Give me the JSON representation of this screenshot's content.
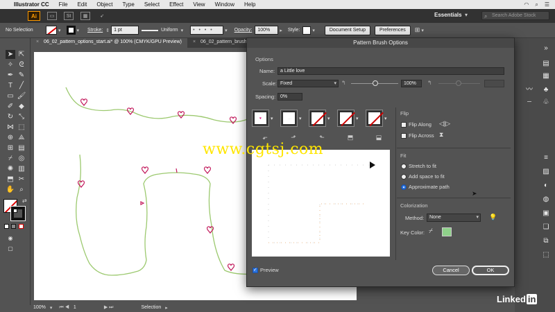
{
  "menubar": {
    "app_name": "Illustrator CC",
    "items": [
      "File",
      "Edit",
      "Object",
      "Type",
      "Select",
      "Effect",
      "View",
      "Window",
      "Help"
    ]
  },
  "appbar": {
    "logo": "Ai",
    "st_label": "St",
    "workspace": "Essentials",
    "search_placeholder": "Search Adobe Stock"
  },
  "control_bar": {
    "selection": "No Selection",
    "stroke_label": "Stroke:",
    "stroke_weight": "1 pt",
    "profile": "Uniform",
    "opacity_label": "Opacity:",
    "opacity_value": "100%",
    "style_label": "Style:",
    "document_setup": "Document Setup",
    "preferences": "Preferences"
  },
  "doc_tabs": [
    {
      "label": "06_02_pattern_options_start.ai* @ 100% (CMYK/GPU Preview)"
    },
    {
      "label": "06_02_pattern_brush_option"
    }
  ],
  "status_bar": {
    "zoom": "100%",
    "artboard": "1",
    "tool": "Selection"
  },
  "dialog": {
    "title": "Pattern Brush Options",
    "options_heading": "Options",
    "name_label": "Name:",
    "name_value": "a Little love",
    "scale_label": "Scale:",
    "scale_mode": "Fixed",
    "scale_value": "100%",
    "spacing_label": "Spacing:",
    "spacing_value": "0%",
    "flip_heading": "Flip",
    "flip_along": "Flip Along",
    "flip_across": "Flip Across",
    "fit_heading": "Fit",
    "fit_options": [
      "Stretch to fit",
      "Add space to fit",
      "Approximate path"
    ],
    "fit_selected": "Approximate path",
    "colorization_heading": "Colorization",
    "method_label": "Method:",
    "method_value": "None",
    "key_color_label": "Key Color:",
    "key_color": "#8fd18a",
    "preview_label": "Preview",
    "cancel": "Cancel",
    "ok": "OK"
  },
  "watermark": "www.cgtsj.com",
  "brand": {
    "linked": "Linked",
    "in": "in"
  },
  "colors": {
    "stroke_line": "#9cc96f",
    "hearts": "#c2185b",
    "ai_orange": "#ff9a00",
    "selected_blue": "#2b74e0"
  }
}
